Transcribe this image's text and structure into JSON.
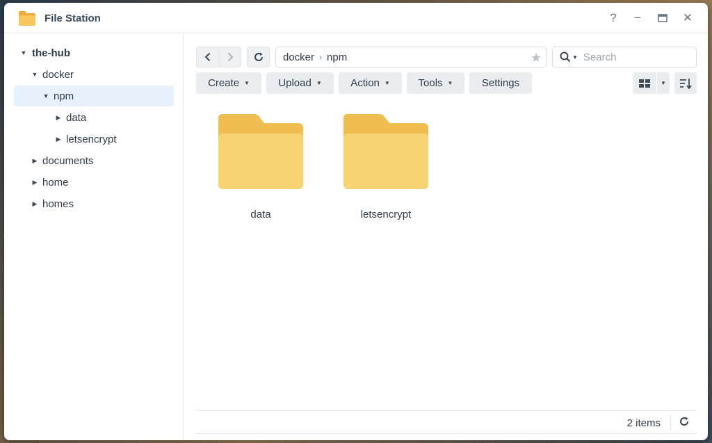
{
  "window": {
    "title": "File Station",
    "help_glyph": "?",
    "minimize_glyph": "−",
    "close_glyph": "✕"
  },
  "tree": {
    "root": "the-hub",
    "docker": "docker",
    "npm": "npm",
    "data": "data",
    "letsencrypt": "letsencrypt",
    "documents": "documents",
    "home": "home",
    "homes": "homes"
  },
  "path": {
    "segments": [
      "docker",
      "npm"
    ],
    "separator": "›"
  },
  "search": {
    "placeholder": "Search",
    "value": ""
  },
  "toolbar": {
    "create": "Create",
    "upload": "Upload",
    "action": "Action",
    "tools": "Tools",
    "settings": "Settings"
  },
  "files": [
    {
      "name": "data",
      "type": "folder"
    },
    {
      "name": "letsencrypt",
      "type": "folder"
    }
  ],
  "status": {
    "count_text": "2 items"
  },
  "colors": {
    "folder_back": "#f2bd50",
    "folder_front": "#f7d374",
    "selection": "#e7f1fb",
    "accent": "#394a5c"
  },
  "icons": {
    "app": "folder-icon",
    "back": "chevron-left-icon",
    "forward": "chevron-right-icon",
    "refresh": "refresh-icon",
    "favorite": "star-icon",
    "search": "search-icon",
    "view": "grid-view-icon",
    "sort": "sort-icon"
  }
}
